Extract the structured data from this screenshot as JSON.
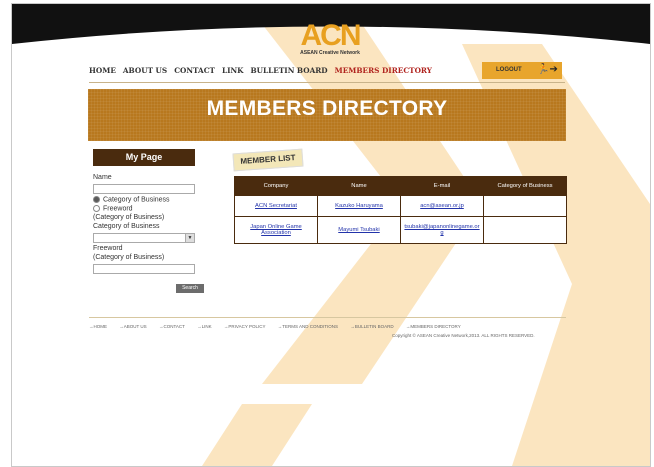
{
  "logo": {
    "text": "ACN",
    "subtitle": "ASEAN Creative Network"
  },
  "nav": {
    "items": [
      {
        "label": "HOME",
        "name": "nav-home"
      },
      {
        "label": "ABOUT US",
        "name": "nav-about-us"
      },
      {
        "label": "CONTACT",
        "name": "nav-contact"
      },
      {
        "label": "LINK",
        "name": "nav-link"
      },
      {
        "label": "BULLETIN BOARD",
        "name": "nav-bulletin-board"
      },
      {
        "label": "MEMBERS DIRECTORY",
        "name": "nav-members-directory"
      }
    ],
    "logout_label": "LOGOUT"
  },
  "banner": {
    "title": "MEMBERS DIRECTORY"
  },
  "sidebar": {
    "title": "My Page",
    "name_label": "Name",
    "radio_category": "Category of Business",
    "radio_freeword": "Freeword",
    "note1": "(Category of Business)",
    "category_label": "Category of Business",
    "freeword_label": "Freeword",
    "note2": "(Category of Business)",
    "search_label": "Search"
  },
  "member_list": {
    "title": "MEMBER LIST",
    "headers": [
      "Company",
      "Name",
      "E-mail",
      "Category of Business"
    ],
    "rows": [
      [
        "ACN Secretariat",
        "Kazuko Haruyama",
        "acn@asean.or.jp",
        ""
      ],
      [
        "Japan Online Game Association",
        "Mayumi Tsubaki",
        "tsubaki@japanonlinegame.org",
        ""
      ]
    ]
  },
  "footer": {
    "links": [
      "→HOME",
      "→ABOUT US",
      "→CONTACT",
      "→LINK",
      "→PRIVACY POLICY",
      "→TERMS AND CONDITIONS",
      "→BULLETIN BOARD",
      "→MEMBERS DIRECTORY"
    ],
    "copyright": "Copyright © ASEAN Creative Network,2013. ALL RIGHTS RESERVED."
  },
  "colors": {
    "accent": "#e8a52c",
    "banner": "#b8781e",
    "dark": "#4a2b0e",
    "active_nav": "#b0231e"
  }
}
